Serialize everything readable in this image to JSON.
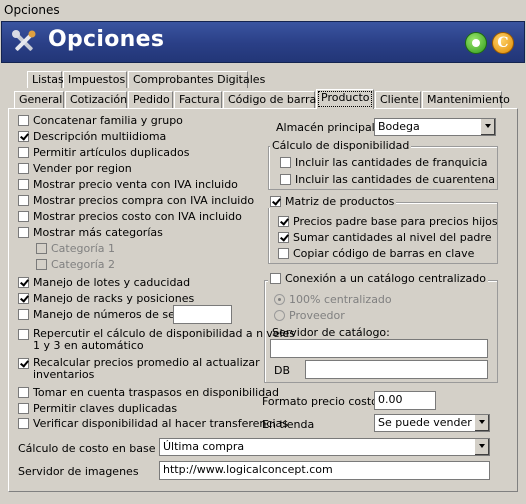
{
  "window": {
    "title": "Opciones"
  },
  "banner": {
    "title": "Opciones",
    "coin_letter": "C"
  },
  "tabs_row1": [
    "Listas",
    "Impuestos",
    "Comprobantes Digitales"
  ],
  "tabs_row2": [
    "General",
    "Cotización",
    "Pedido",
    "Factura",
    "Código de barras",
    "Producto",
    "Cliente",
    "Mantenimiento"
  ],
  "active_tab": "Producto",
  "left": {
    "concatenar": "Concatenar familia y grupo",
    "descripcion": "Descripción multiidioma",
    "permitir_duplicados": "Permitir artículos duplicados",
    "vender_region": "Vender por region",
    "precio_venta_iva": "Mostrar precio venta con IVA incluido",
    "precios_compra_iva": "Mostrar precios compra con IVA incluido",
    "precios_costo_iva": "Mostrar precios costo con IVA incluido",
    "mas_categorias": "Mostrar más categorías",
    "categoria1": "Categoría 1",
    "categoria2": "Categoría 2",
    "lotes": "Manejo de lotes y caducidad",
    "racks": "Manejo de racks y posiciones",
    "numeros_serie": "Manejo de números de serie",
    "numeros_serie_value": "",
    "repercutir": "Repercutir el cálculo de disponibilidad a niveles\n1 y 3 en automático",
    "recalcular": "Recalcular precios promedio al actualizar\ninventarios",
    "traspasos": "Tomar en cuenta traspasos en disponibilidad",
    "claves_duplicadas": "Permitir claves duplicadas",
    "verificar": "Verificar disponibilidad al hacer transferencias"
  },
  "right": {
    "almacen_label": "Almacén principal",
    "almacen_value": "Bodega",
    "calculo_group": "Cálculo de disponibilidad",
    "franquicia": "Incluir las cantidades de franquicia",
    "cuarentena": "Incluir las cantidades de cuarentena",
    "matriz_group": "Matriz de productos",
    "precios_padre": "Precios padre base para precios hijos",
    "sumar": "Sumar cantidades al nivel del padre",
    "copiar": "Copiar código de barras en clave",
    "conexion_group": "Conexión a un catálogo centralizado",
    "centralizado": "100% centralizado",
    "proveedor": "Proveedor",
    "servidor_catalogo": "Servidor de catálogo:",
    "servidor_catalogo_value": "",
    "db_label": "DB",
    "db_value": "",
    "formato_label": "Formato precio costo",
    "formato_value": "0.00",
    "en_tienda_label": "En tienda",
    "en_tienda_value": "Se puede vender"
  },
  "bottom": {
    "calculo_costo_label": "Cálculo de costo en base a",
    "calculo_costo_value": "Última compra",
    "servidor_imagenes_label": "Servidor de imagenes",
    "servidor_imagenes_value": "http://www.logicalconcept.com"
  },
  "checks": {
    "concatenar": false,
    "descripcion": true,
    "permitir_duplicados": false,
    "vender_region": false,
    "precio_venta_iva": false,
    "precios_compra_iva": false,
    "precios_costo_iva": false,
    "mas_categorias": false,
    "categoria1": false,
    "categoria2": false,
    "lotes": true,
    "racks": true,
    "numeros_serie": false,
    "repercutir": false,
    "recalcular": true,
    "traspasos": false,
    "claves_duplicadas": false,
    "verificar": false,
    "franquicia": false,
    "cuarentena": false,
    "matriz": true,
    "precios_padre": true,
    "sumar": true,
    "copiar": false,
    "conexion": false
  },
  "radios": {
    "centralizado": true,
    "proveedor": false
  }
}
